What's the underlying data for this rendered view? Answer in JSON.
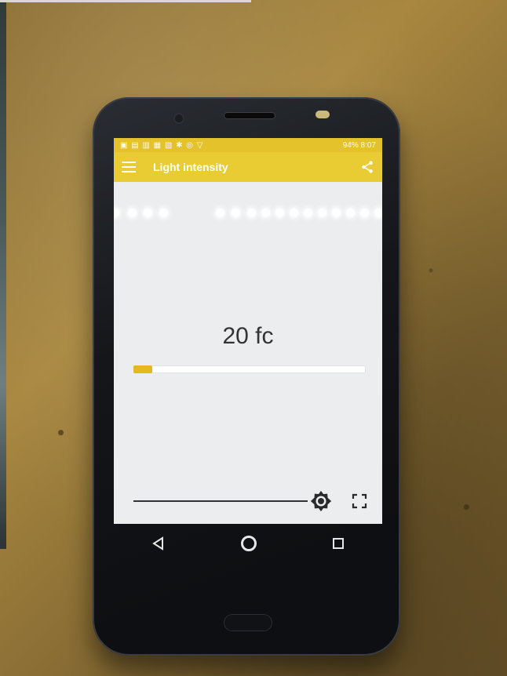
{
  "app": {
    "title": "Light intensity"
  },
  "status_bar": {
    "battery": "94%",
    "time": "8:07"
  },
  "reading": {
    "value": "20 fc",
    "level_fraction": 0.08
  },
  "colors": {
    "accent": "#e9cb34",
    "bar_fill": "#e3b920"
  },
  "icons": {
    "menu": "hamburger-menu-icon",
    "share": "share-icon",
    "brightness": "brightness-icon",
    "fullscreen": "fullscreen-icon",
    "back": "back-triangle-icon",
    "home": "home-circle-icon",
    "recents": "recents-square-icon"
  }
}
